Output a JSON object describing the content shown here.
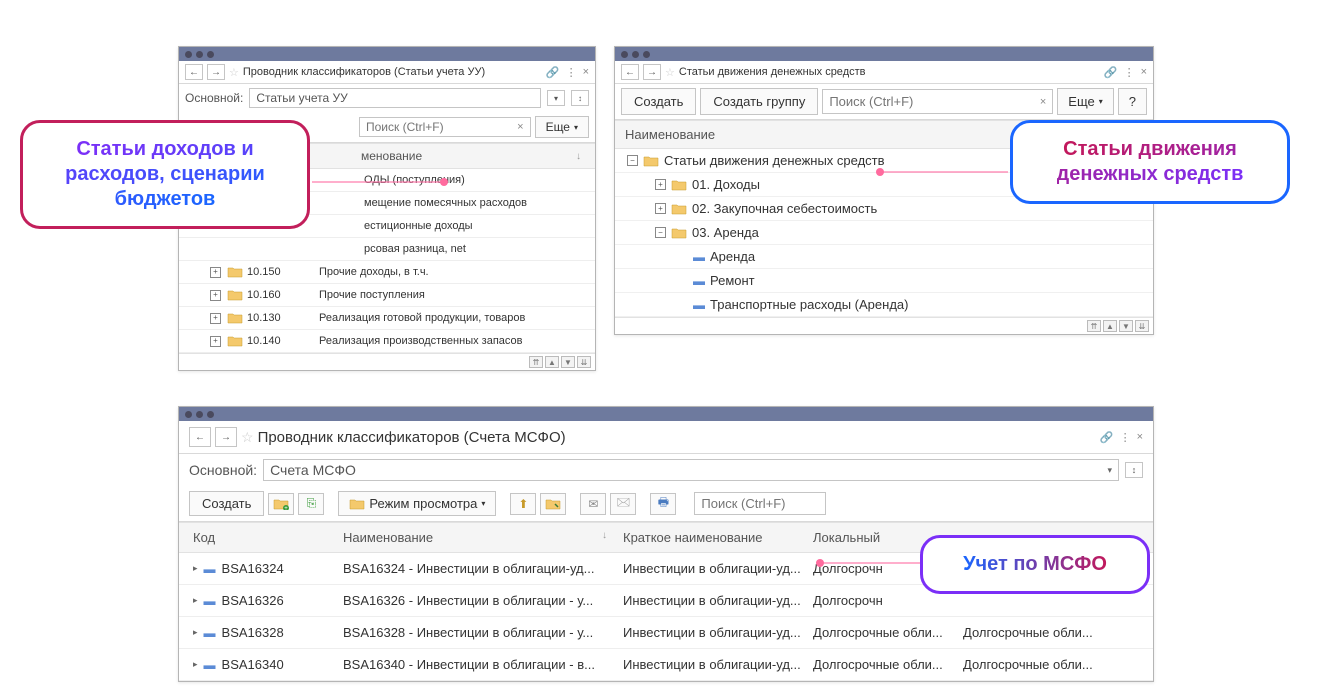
{
  "callouts": {
    "left": "Статьи доходов и расходов, сценарии бюджетов",
    "right": "Статьи движения денежных средств",
    "bottom": "Учет по МСФО"
  },
  "win1": {
    "title": "Проводник классификаторов (Статьи учета УУ)",
    "main_label": "Основной:",
    "main_value": "Статьи учета УУ",
    "search_placeholder": "Поиск (Ctrl+F)",
    "more_btn": "Еще",
    "col_name": "менование",
    "rows": [
      {
        "code": "",
        "name": "ОДЫ (поступления)"
      },
      {
        "code": "",
        "name": "мещение помесячных расходов"
      },
      {
        "code": "",
        "name": "естиционные доходы"
      },
      {
        "code": "",
        "name": "рсовая разница, net"
      },
      {
        "code": "10.150",
        "name": "Прочие доходы, в т.ч."
      },
      {
        "code": "10.160",
        "name": "Прочие поступления"
      },
      {
        "code": "10.130",
        "name": "Реализация готовой продукции, товаров"
      },
      {
        "code": "10.140",
        "name": "Реализация производственных запасов"
      }
    ]
  },
  "win2": {
    "title": "Статьи движения денежных средств",
    "create_btn": "Создать",
    "create_group_btn": "Создать группу",
    "search_placeholder": "Поиск (Ctrl+F)",
    "more_btn": "Еще",
    "help_btn": "?",
    "col_name": "Наименование",
    "tree": {
      "root": "Статьи движения денежных средств",
      "children": [
        {
          "label": "01. Доходы",
          "type": "folder",
          "exp": "+"
        },
        {
          "label": "02. Закупочная себестоимость",
          "type": "folder",
          "exp": "+"
        },
        {
          "label": "03. Аренда",
          "type": "folder",
          "exp": "-",
          "children": [
            {
              "label": "Аренда",
              "type": "item"
            },
            {
              "label": "Ремонт",
              "type": "item"
            },
            {
              "label": "Транспортные расходы (Аренда)",
              "type": "item"
            }
          ]
        }
      ]
    }
  },
  "win3": {
    "title": "Проводник классификаторов (Счета МСФО)",
    "main_label": "Основной:",
    "main_value": "Счета МСФО",
    "create_btn": "Создать",
    "view_mode_btn": "Режим просмотра",
    "search_placeholder": "Поиск (Ctrl+F)",
    "columns": [
      "Код",
      "Наименование",
      "Краткое наименование",
      "Локальный"
    ],
    "rows": [
      {
        "code": "BSA16324",
        "name": "BSA16324 - Инвестиции в облигации-уд...",
        "short": "Инвестиции в облигации-уд...",
        "local": "Долгосрочн"
      },
      {
        "code": "BSA16326",
        "name": "BSA16326 - Инвестиции в облигации - у...",
        "short": "Инвестиции в облигации-уд...",
        "local": "Долгосрочн"
      },
      {
        "code": "BSA16328",
        "name": "BSA16328 - Инвестиции в облигации - у...",
        "short": "Инвестиции в облигации-уд...",
        "local": "Долгосрочные обли..."
      },
      {
        "code": "BSA16340",
        "name": "BSA16340 - Инвестиции в облигации - в...",
        "short": "Инвестиции в облигации-уд...",
        "local": "Долгосрочные обли..."
      }
    ],
    "extra_col": "Долгосрочные обли..."
  }
}
